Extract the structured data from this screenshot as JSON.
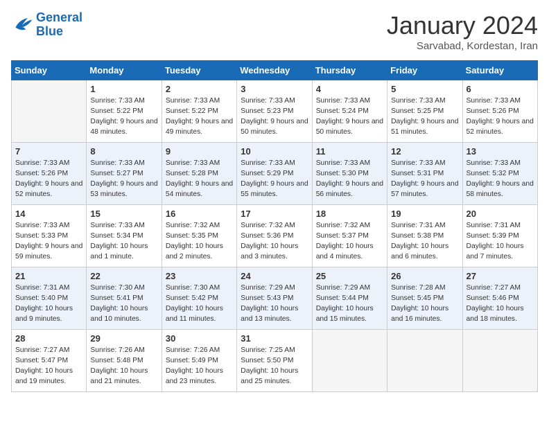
{
  "logo": {
    "line1": "General",
    "line2": "Blue"
  },
  "title": "January 2024",
  "subtitle": "Sarvabad, Kordestan, Iran",
  "weekdays": [
    "Sunday",
    "Monday",
    "Tuesday",
    "Wednesday",
    "Thursday",
    "Friday",
    "Saturday"
  ],
  "weeks": [
    [
      {
        "day": "",
        "empty": true
      },
      {
        "day": "1",
        "sunrise": "7:33 AM",
        "sunset": "5:22 PM",
        "daylight": "9 hours and 48 minutes."
      },
      {
        "day": "2",
        "sunrise": "7:33 AM",
        "sunset": "5:22 PM",
        "daylight": "9 hours and 49 minutes."
      },
      {
        "day": "3",
        "sunrise": "7:33 AM",
        "sunset": "5:23 PM",
        "daylight": "9 hours and 50 minutes."
      },
      {
        "day": "4",
        "sunrise": "7:33 AM",
        "sunset": "5:24 PM",
        "daylight": "9 hours and 50 minutes."
      },
      {
        "day": "5",
        "sunrise": "7:33 AM",
        "sunset": "5:25 PM",
        "daylight": "9 hours and 51 minutes."
      },
      {
        "day": "6",
        "sunrise": "7:33 AM",
        "sunset": "5:26 PM",
        "daylight": "9 hours and 52 minutes."
      }
    ],
    [
      {
        "day": "7",
        "sunrise": "7:33 AM",
        "sunset": "5:26 PM",
        "daylight": "9 hours and 52 minutes."
      },
      {
        "day": "8",
        "sunrise": "7:33 AM",
        "sunset": "5:27 PM",
        "daylight": "9 hours and 53 minutes."
      },
      {
        "day": "9",
        "sunrise": "7:33 AM",
        "sunset": "5:28 PM",
        "daylight": "9 hours and 54 minutes."
      },
      {
        "day": "10",
        "sunrise": "7:33 AM",
        "sunset": "5:29 PM",
        "daylight": "9 hours and 55 minutes."
      },
      {
        "day": "11",
        "sunrise": "7:33 AM",
        "sunset": "5:30 PM",
        "daylight": "9 hours and 56 minutes."
      },
      {
        "day": "12",
        "sunrise": "7:33 AM",
        "sunset": "5:31 PM",
        "daylight": "9 hours and 57 minutes."
      },
      {
        "day": "13",
        "sunrise": "7:33 AM",
        "sunset": "5:32 PM",
        "daylight": "9 hours and 58 minutes."
      }
    ],
    [
      {
        "day": "14",
        "sunrise": "7:33 AM",
        "sunset": "5:33 PM",
        "daylight": "9 hours and 59 minutes."
      },
      {
        "day": "15",
        "sunrise": "7:33 AM",
        "sunset": "5:34 PM",
        "daylight": "10 hours and 1 minute."
      },
      {
        "day": "16",
        "sunrise": "7:32 AM",
        "sunset": "5:35 PM",
        "daylight": "10 hours and 2 minutes."
      },
      {
        "day": "17",
        "sunrise": "7:32 AM",
        "sunset": "5:36 PM",
        "daylight": "10 hours and 3 minutes."
      },
      {
        "day": "18",
        "sunrise": "7:32 AM",
        "sunset": "5:37 PM",
        "daylight": "10 hours and 4 minutes."
      },
      {
        "day": "19",
        "sunrise": "7:31 AM",
        "sunset": "5:38 PM",
        "daylight": "10 hours and 6 minutes."
      },
      {
        "day": "20",
        "sunrise": "7:31 AM",
        "sunset": "5:39 PM",
        "daylight": "10 hours and 7 minutes."
      }
    ],
    [
      {
        "day": "21",
        "sunrise": "7:31 AM",
        "sunset": "5:40 PM",
        "daylight": "10 hours and 9 minutes."
      },
      {
        "day": "22",
        "sunrise": "7:30 AM",
        "sunset": "5:41 PM",
        "daylight": "10 hours and 10 minutes."
      },
      {
        "day": "23",
        "sunrise": "7:30 AM",
        "sunset": "5:42 PM",
        "daylight": "10 hours and 11 minutes."
      },
      {
        "day": "24",
        "sunrise": "7:29 AM",
        "sunset": "5:43 PM",
        "daylight": "10 hours and 13 minutes."
      },
      {
        "day": "25",
        "sunrise": "7:29 AM",
        "sunset": "5:44 PM",
        "daylight": "10 hours and 15 minutes."
      },
      {
        "day": "26",
        "sunrise": "7:28 AM",
        "sunset": "5:45 PM",
        "daylight": "10 hours and 16 minutes."
      },
      {
        "day": "27",
        "sunrise": "7:27 AM",
        "sunset": "5:46 PM",
        "daylight": "10 hours and 18 minutes."
      }
    ],
    [
      {
        "day": "28",
        "sunrise": "7:27 AM",
        "sunset": "5:47 PM",
        "daylight": "10 hours and 19 minutes."
      },
      {
        "day": "29",
        "sunrise": "7:26 AM",
        "sunset": "5:48 PM",
        "daylight": "10 hours and 21 minutes."
      },
      {
        "day": "30",
        "sunrise": "7:26 AM",
        "sunset": "5:49 PM",
        "daylight": "10 hours and 23 minutes."
      },
      {
        "day": "31",
        "sunrise": "7:25 AM",
        "sunset": "5:50 PM",
        "daylight": "10 hours and 25 minutes."
      },
      {
        "day": "",
        "empty": true
      },
      {
        "day": "",
        "empty": true
      },
      {
        "day": "",
        "empty": true
      }
    ]
  ]
}
